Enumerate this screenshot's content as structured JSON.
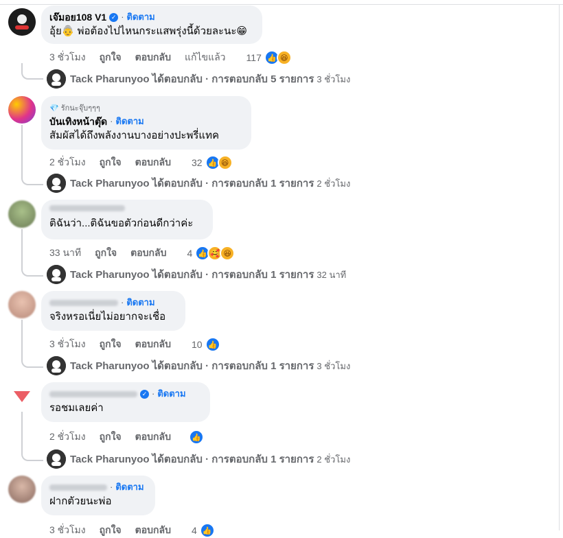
{
  "comments": [
    {
      "name": "เจ๊มอย108 V1",
      "verified": true,
      "follow": "ติดตาม",
      "text": "อุ้ย👵 พ่อต้องไปไหนกระแสพรุ่งนี้ด้วยละนะ😁",
      "time": "3 ชั่วโมง",
      "like": "ถูกใจ",
      "reply": "ตอบกลับ",
      "edited": "แก้ไขแล้ว",
      "reaction_count": "117",
      "reply_summary": {
        "name": "Tack Pharunyoo",
        "text": "ได้ตอบกลับ · การตอบกลับ 5 รายการ",
        "time": "3 ชั่วโมง"
      }
    },
    {
      "badge": "รักนะจุ๊บๆๆๆ",
      "name": "บันเทิงหน้าตุ๊ด",
      "follow": "ติดตาม",
      "text": "สัมผัสได้ถึงพลังงานบางอย่างปะพรี่แทค",
      "time": "2 ชั่วโมง",
      "like": "ถูกใจ",
      "reply": "ตอบกลับ",
      "reaction_count": "32",
      "reply_summary": {
        "name": "Tack Pharunyoo",
        "text": "ได้ตอบกลับ · การตอบกลับ 1 รายการ",
        "time": "2 ชั่วโมง"
      }
    },
    {
      "text": "ติฉันว่า...ติฉันขอตัวก่อนดีกว่าค่ะ",
      "time": "33 นาที",
      "like": "ถูกใจ",
      "reply": "ตอบกลับ",
      "reaction_count": "4",
      "reply_summary": {
        "name": "Tack Pharunyoo",
        "text": "ได้ตอบกลับ · การตอบกลับ 1 รายการ",
        "time": "32 นาที"
      }
    },
    {
      "follow": "ติดตาม",
      "text": "จริงหรอเนี่ยไม่อยากจะเชื่อ",
      "time": "3 ชั่วโมง",
      "like": "ถูกใจ",
      "reply": "ตอบกลับ",
      "reaction_count": "10",
      "reply_summary": {
        "name": "Tack Pharunyoo",
        "text": "ได้ตอบกลับ · การตอบกลับ 1 รายการ",
        "time": "3 ชั่วโมง"
      }
    },
    {
      "verified": true,
      "follow": "ติดตาม",
      "text": "รอชมเลยค่า",
      "time": "2 ชั่วโมง",
      "like": "ถูกใจ",
      "reply": "ตอบกลับ",
      "reply_summary": {
        "name": "Tack Pharunyoo",
        "text": "ได้ตอบกลับ · การตอบกลับ 1 รายการ",
        "time": "2 ชั่วโมง"
      }
    },
    {
      "follow": "ติดตาม",
      "text": "ฝากตัวยนะพ่อ",
      "time": "3 ชั่วโมง",
      "like": "ถูกใจ",
      "reply": "ตอบกลับ",
      "reaction_count": "4"
    }
  ],
  "colors": {
    "link": "#1877f2",
    "bubble": "#f0f2f5",
    "meta": "#65676b"
  },
  "icons": [
    "like-reaction-icon",
    "haha-reaction-icon",
    "care-reaction-icon",
    "verified-badge-icon",
    "gem-badge-icon"
  ]
}
